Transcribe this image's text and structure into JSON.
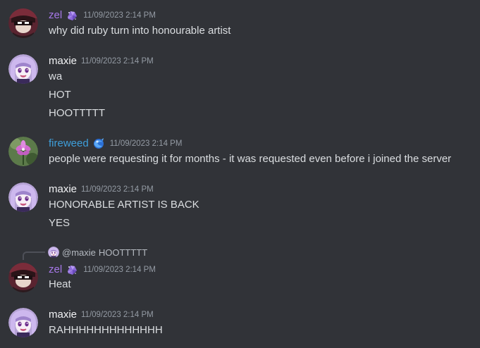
{
  "colors": {
    "background": "#313338",
    "zel_name": "#a678e8",
    "maxie_name": "#f2f3f5",
    "fireweed_name": "#3e9fdb",
    "timestamp": "#949ba4",
    "message_text": "#dbdee1"
  },
  "messages": [
    {
      "author": "zel",
      "badge": "purple-crystal-icon",
      "timestamp": "11/09/2023 2:14 PM",
      "lines": [
        "why did ruby turn into honourable artist"
      ]
    },
    {
      "author": "maxie",
      "timestamp": "11/09/2023 2:14 PM",
      "lines": [
        "wa",
        "HOT",
        "HOOTTTTT"
      ]
    },
    {
      "author": "fireweed",
      "badge": "blue-orb-icon",
      "timestamp": "11/09/2023 2:14 PM",
      "lines": [
        "people were requesting it for months - it was requested even before i joined the server"
      ]
    },
    {
      "author": "maxie",
      "timestamp": "11/09/2023 2:14 PM",
      "lines": [
        "HONORABLE ARTIST IS BACK",
        "YES"
      ]
    },
    {
      "author": "zel",
      "badge": "purple-crystal-icon",
      "timestamp": "11/09/2023 2:14 PM",
      "reply": {
        "mention": "@maxie",
        "text": "HOOTTTTT"
      },
      "lines": [
        "Heat"
      ]
    },
    {
      "author": "maxie",
      "timestamp": "11/09/2023 2:14 PM",
      "lines": [
        "RAHHHHHHHHHHHHH"
      ]
    }
  ]
}
